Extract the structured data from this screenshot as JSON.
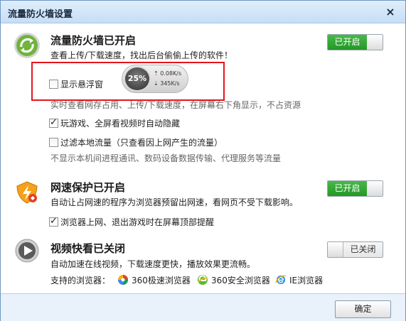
{
  "window": {
    "title": "流量防火墙设置",
    "close_glyph": "×"
  },
  "firewall": {
    "heading": "流量防火墙已开启",
    "subtitle": "查看上传/下载速度，找出后台偷偷上传的软件！",
    "toggle_label": "已开启",
    "float_checkbox_label": "显示悬浮窗",
    "float_checked": false,
    "float_hint": "实时查看网存占用、上传/下载速度，在屏幕右下角显示，不占资源",
    "widget": {
      "percent": "25%",
      "up": "0.08K/s",
      "down": "345K/s"
    },
    "game_checkbox_label": "玩游戏、全屏看视频时自动隐藏",
    "game_checked": true,
    "filter_checkbox_label": "过滤本地流量（只查看因上网产生的流量）",
    "filter_checked": false,
    "filter_hint": "不显示本机间进程通讯、数码设备数据传输、代理服务等流量"
  },
  "speed_protect": {
    "heading": "网速保护已开启",
    "desc": "自动让占网速的程序为浏览器预留出网速，看网页不受下载影响。",
    "toggle_label": "已开启",
    "checkbox_label": "浏览器上网、退出游戏时在屏幕顶部提醒",
    "checked": true
  },
  "video": {
    "heading": "视频快看已关闭",
    "desc": "自动加速在线视频，下载速度更快，播放效果更流畅。",
    "toggle_label": "已关闭",
    "supported_label": "支持的浏览器：",
    "browsers": [
      "360极速浏览器",
      "360安全浏览器",
      "IE浏览器"
    ]
  },
  "footer": {
    "ok_label": "确定"
  },
  "colors": {
    "toggle_on": "#2fa531",
    "red_outline": "#e3161b",
    "title_bar": "#c6def5"
  }
}
